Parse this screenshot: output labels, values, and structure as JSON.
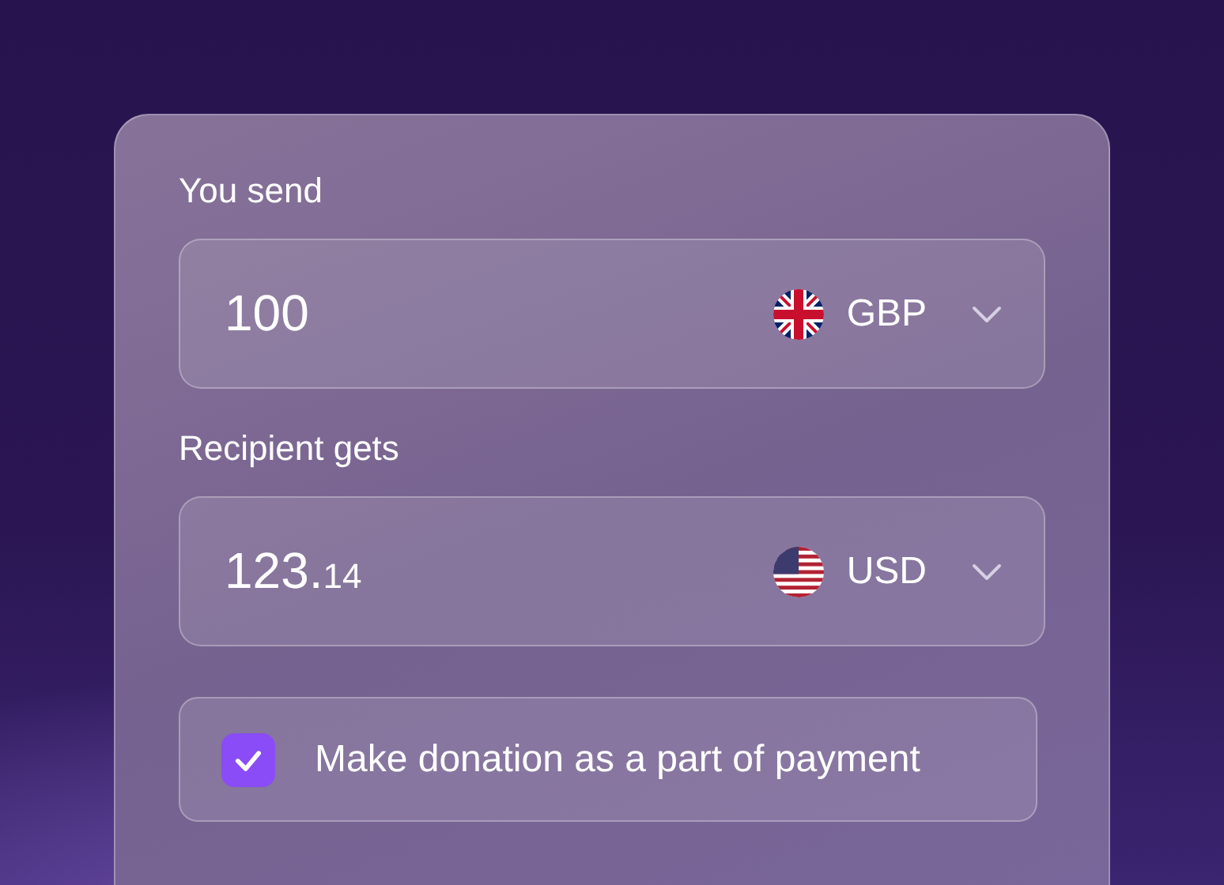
{
  "send": {
    "label": "You send",
    "amount": "100",
    "currency": "GBP",
    "kind": "gb"
  },
  "receive": {
    "label": "Recipient gets",
    "amount": "123.",
    "fraction": "14",
    "currency": "USD",
    "kind": "us"
  },
  "donation": {
    "label": "Make donation as a part of payment",
    "checked": true
  }
}
